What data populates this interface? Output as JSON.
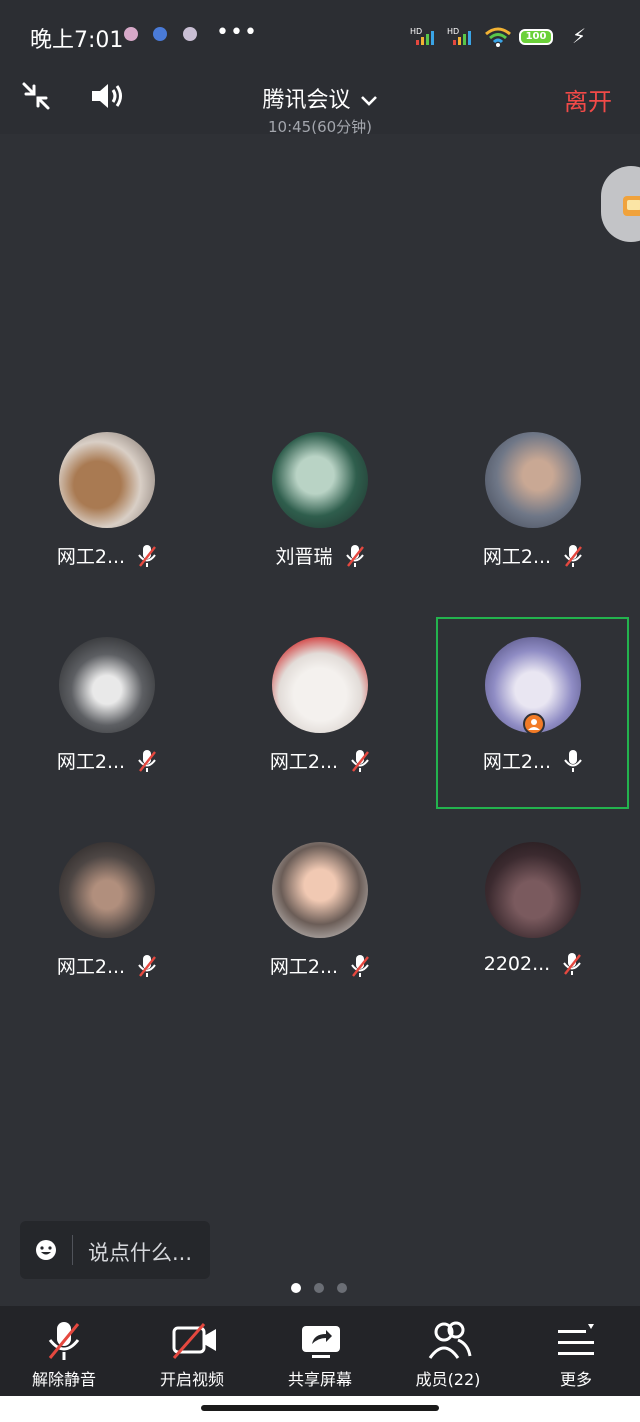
{
  "status_bar": {
    "time": "晚上7:01",
    "battery": "100",
    "signal_labels": [
      "HD",
      "HD"
    ]
  },
  "header": {
    "title": "腾讯会议",
    "duration": "10:45(60分钟)",
    "leave_label": "离开"
  },
  "participants": [
    {
      "name": "网工2...",
      "muted": true
    },
    {
      "name": "刘晋瑞",
      "muted": true
    },
    {
      "name": "网工2...",
      "muted": true
    },
    {
      "name": "网工2...",
      "muted": true
    },
    {
      "name": "网工2...",
      "muted": true
    },
    {
      "name": "网工2...",
      "muted": false,
      "host": true,
      "active_speaker": true
    },
    {
      "name": "网工2...",
      "muted": true
    },
    {
      "name": "网工2...",
      "muted": true
    },
    {
      "name": "2202...",
      "muted": true
    }
  ],
  "chat": {
    "placeholder": "说点什么..."
  },
  "pager": {
    "pages": 3,
    "current": 1
  },
  "toolbar": {
    "unmute_label": "解除静音",
    "video_label": "开启视频",
    "share_label": "共享屏幕",
    "members_label": "成员(22)",
    "more_label": "更多"
  },
  "colors": {
    "background": "#2f3136",
    "leave": "#f24a48",
    "active_speaker_border": "#23b34e",
    "muted_slash": "#e5483f",
    "host_badge": "#f27b27"
  }
}
